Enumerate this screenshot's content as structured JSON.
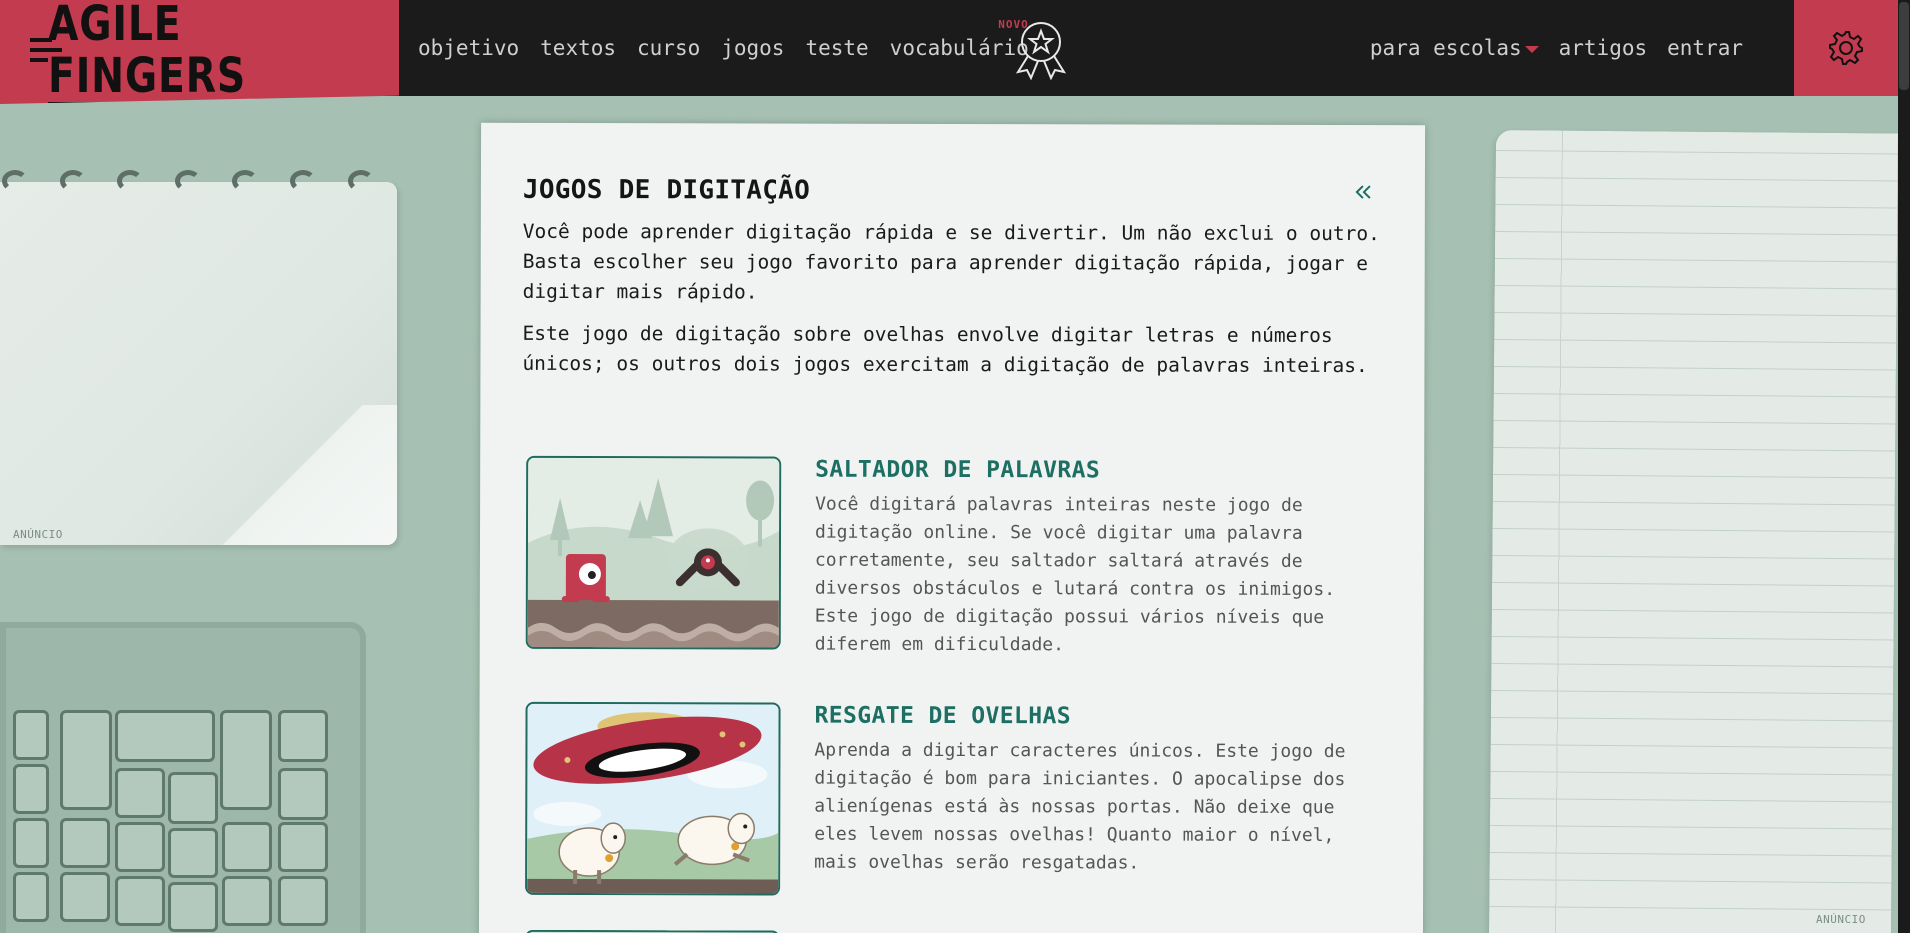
{
  "brand": {
    "name": "AGILE FINGERS"
  },
  "nav": {
    "left": [
      "objetivo",
      "textos",
      "curso",
      "jogos",
      "teste",
      "vocabulário"
    ],
    "new_badge": "NOVO",
    "right": {
      "schools": "para escolas",
      "articles": "artigos",
      "login": "entrar"
    }
  },
  "icons": {
    "medal": "award-medal-icon",
    "settings": "gear-icon",
    "collapse": "double-chevron-left-icon"
  },
  "colors": {
    "accent": "#c33b4e",
    "nav_bg": "#1b1b1b",
    "title_teal": "#1d6f63",
    "page_bg": "#a6c0b3"
  },
  "ads": {
    "left_label": "ANÚNCIO",
    "right_label": "ANÚNCIO"
  },
  "main": {
    "title": "JOGOS DE DIGITAÇÃO",
    "intro_1": "Você pode aprender digitação rápida e se divertir. Um não exclui o outro. Basta escolher seu jogo favorito para aprender digitação rápida, jogar e digitar mais rápido.",
    "intro_2": "Este jogo de digitação sobre ovelhas envolve digitar letras e números únicos; os outros dois jogos exercitam a digitação de palavras inteiras.",
    "games": [
      {
        "title": "SALTADOR DE PALAVRAS",
        "description": "Você digitará palavras inteiras neste jogo de digitação online. Se você digitar uma palavra corretamente, seu saltador saltará através de diversos obstáculos e lutará contra os inimigos. Este jogo de digitação possui vários níveis que diferem em dificuldade."
      },
      {
        "title": "RESGATE DE OVELHAS",
        "description": "Aprenda a digitar caracteres únicos. Este jogo de digitação é bom para iniciantes. O apocalipse dos alienígenas está às nossas portas. Não deixe que eles levem nossas ovelhas! Quanto maior o nível, mais ovelhas serão resgatadas."
      }
    ]
  }
}
